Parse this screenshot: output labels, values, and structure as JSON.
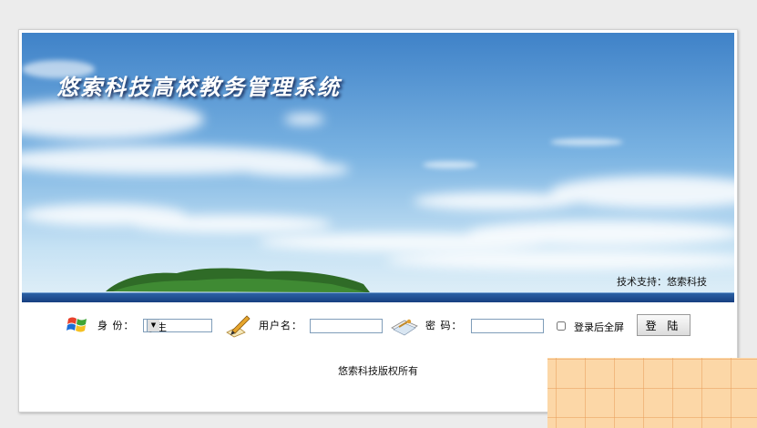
{
  "banner": {
    "title": "悠索科技高校教务管理系统",
    "support": "技术支持：悠索科技"
  },
  "login": {
    "role_label": "身 份：",
    "role_value": "学生",
    "username_label": "用户名：",
    "username_value": "",
    "password_label": "密 码：",
    "password_value": "",
    "fullscreen_label": "登录后全屏",
    "fullscreen_checked": false,
    "submit_label": "登 陆"
  },
  "footer": {
    "copyright": "悠索科技版权所有"
  },
  "icons": {
    "role": "windows-logo-icon",
    "username": "pen-writing-icon",
    "password": "notebook-key-icon"
  },
  "colors": {
    "sky_top": "#3f82c8",
    "sea": "#1f4e93",
    "grid_overlay": "#fcd7a7"
  }
}
